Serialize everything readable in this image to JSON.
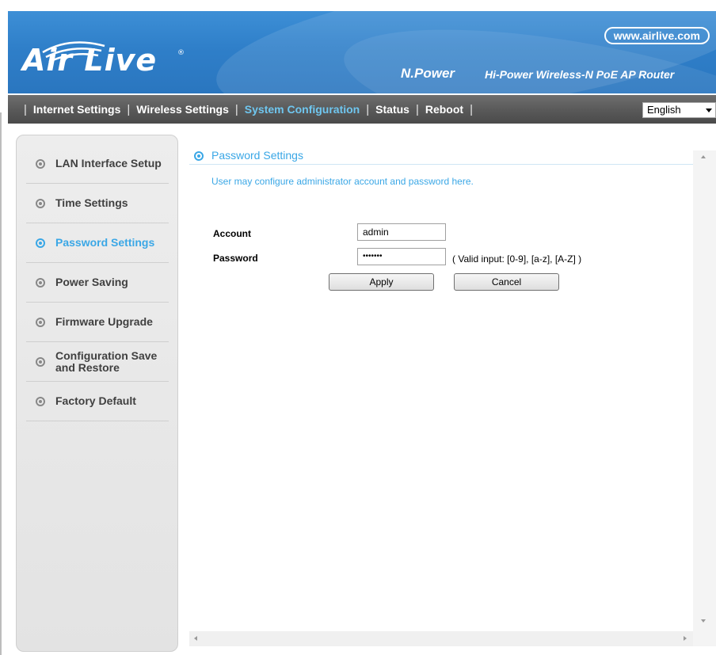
{
  "header": {
    "logo_text": "Air Live",
    "logo_reg": "®",
    "url": "www.airlive.com",
    "brand": "N.Power",
    "tagline": "Hi-Power Wireless-N PoE AP Router"
  },
  "nav": {
    "items": [
      {
        "label": "Internet Settings",
        "active": false
      },
      {
        "label": "Wireless Settings",
        "active": false
      },
      {
        "label": "System Configuration",
        "active": true
      },
      {
        "label": "Status",
        "active": false
      },
      {
        "label": "Reboot",
        "active": false
      }
    ],
    "language": "English"
  },
  "sidebar": {
    "items": [
      {
        "label": "LAN Interface Setup",
        "active": false
      },
      {
        "label": "Time Settings",
        "active": false
      },
      {
        "label": "Password Settings",
        "active": true
      },
      {
        "label": "Power Saving",
        "active": false
      },
      {
        "label": "Firmware Upgrade",
        "active": false
      },
      {
        "label": "Configuration Save and Restore",
        "active": false
      },
      {
        "label": "Factory Default",
        "active": false
      }
    ]
  },
  "content": {
    "section_title": "Password Settings",
    "description": "User may configure administrator account and password here.",
    "account_label": "Account",
    "account_value": "admin",
    "password_label": "Password",
    "password_value": "•••••••",
    "password_hint": "( Valid input: [0-9], [a-z], [A-Z] )",
    "apply_label": "Apply",
    "cancel_label": "Cancel"
  },
  "colors": {
    "accent": "#3aa7e6",
    "banner": "#2f7fc9",
    "navbar": "#5a5a5a"
  }
}
